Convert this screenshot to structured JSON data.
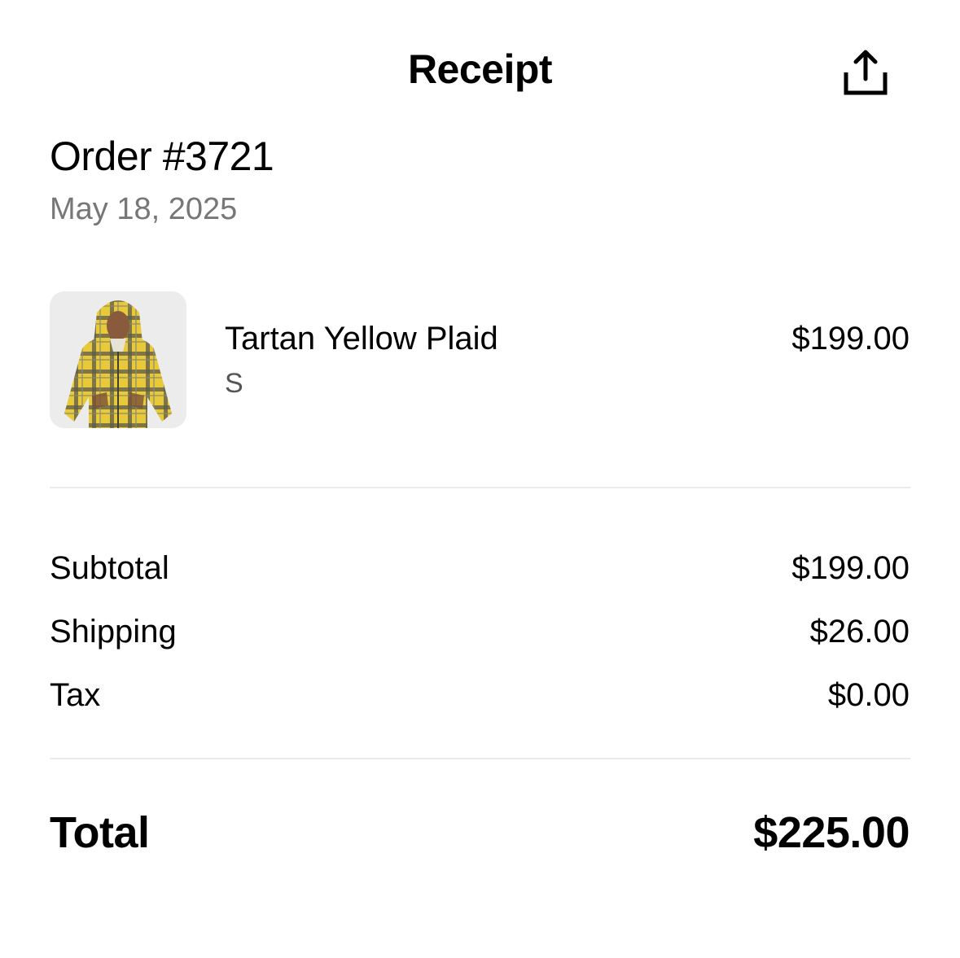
{
  "header": {
    "title": "Receipt",
    "share_icon": "share-upload-icon"
  },
  "order": {
    "number": "Order #3721",
    "date": "May 18, 2025"
  },
  "items": [
    {
      "name": "Tartan Yellow Plaid",
      "variant": "S",
      "price": "$199.00",
      "thumbnail": "yellow-plaid-hoodie-photo"
    }
  ],
  "summary": {
    "subtotal_label": "Subtotal",
    "subtotal_value": "$199.00",
    "shipping_label": "Shipping",
    "shipping_value": "$26.00",
    "tax_label": "Tax",
    "tax_value": "$0.00"
  },
  "total": {
    "label": "Total",
    "value": "$225.00"
  },
  "colors": {
    "text_primary": "#000000",
    "text_secondary": "#777777",
    "divider": "#ebebeb",
    "thumb_bg": "#ececec"
  }
}
